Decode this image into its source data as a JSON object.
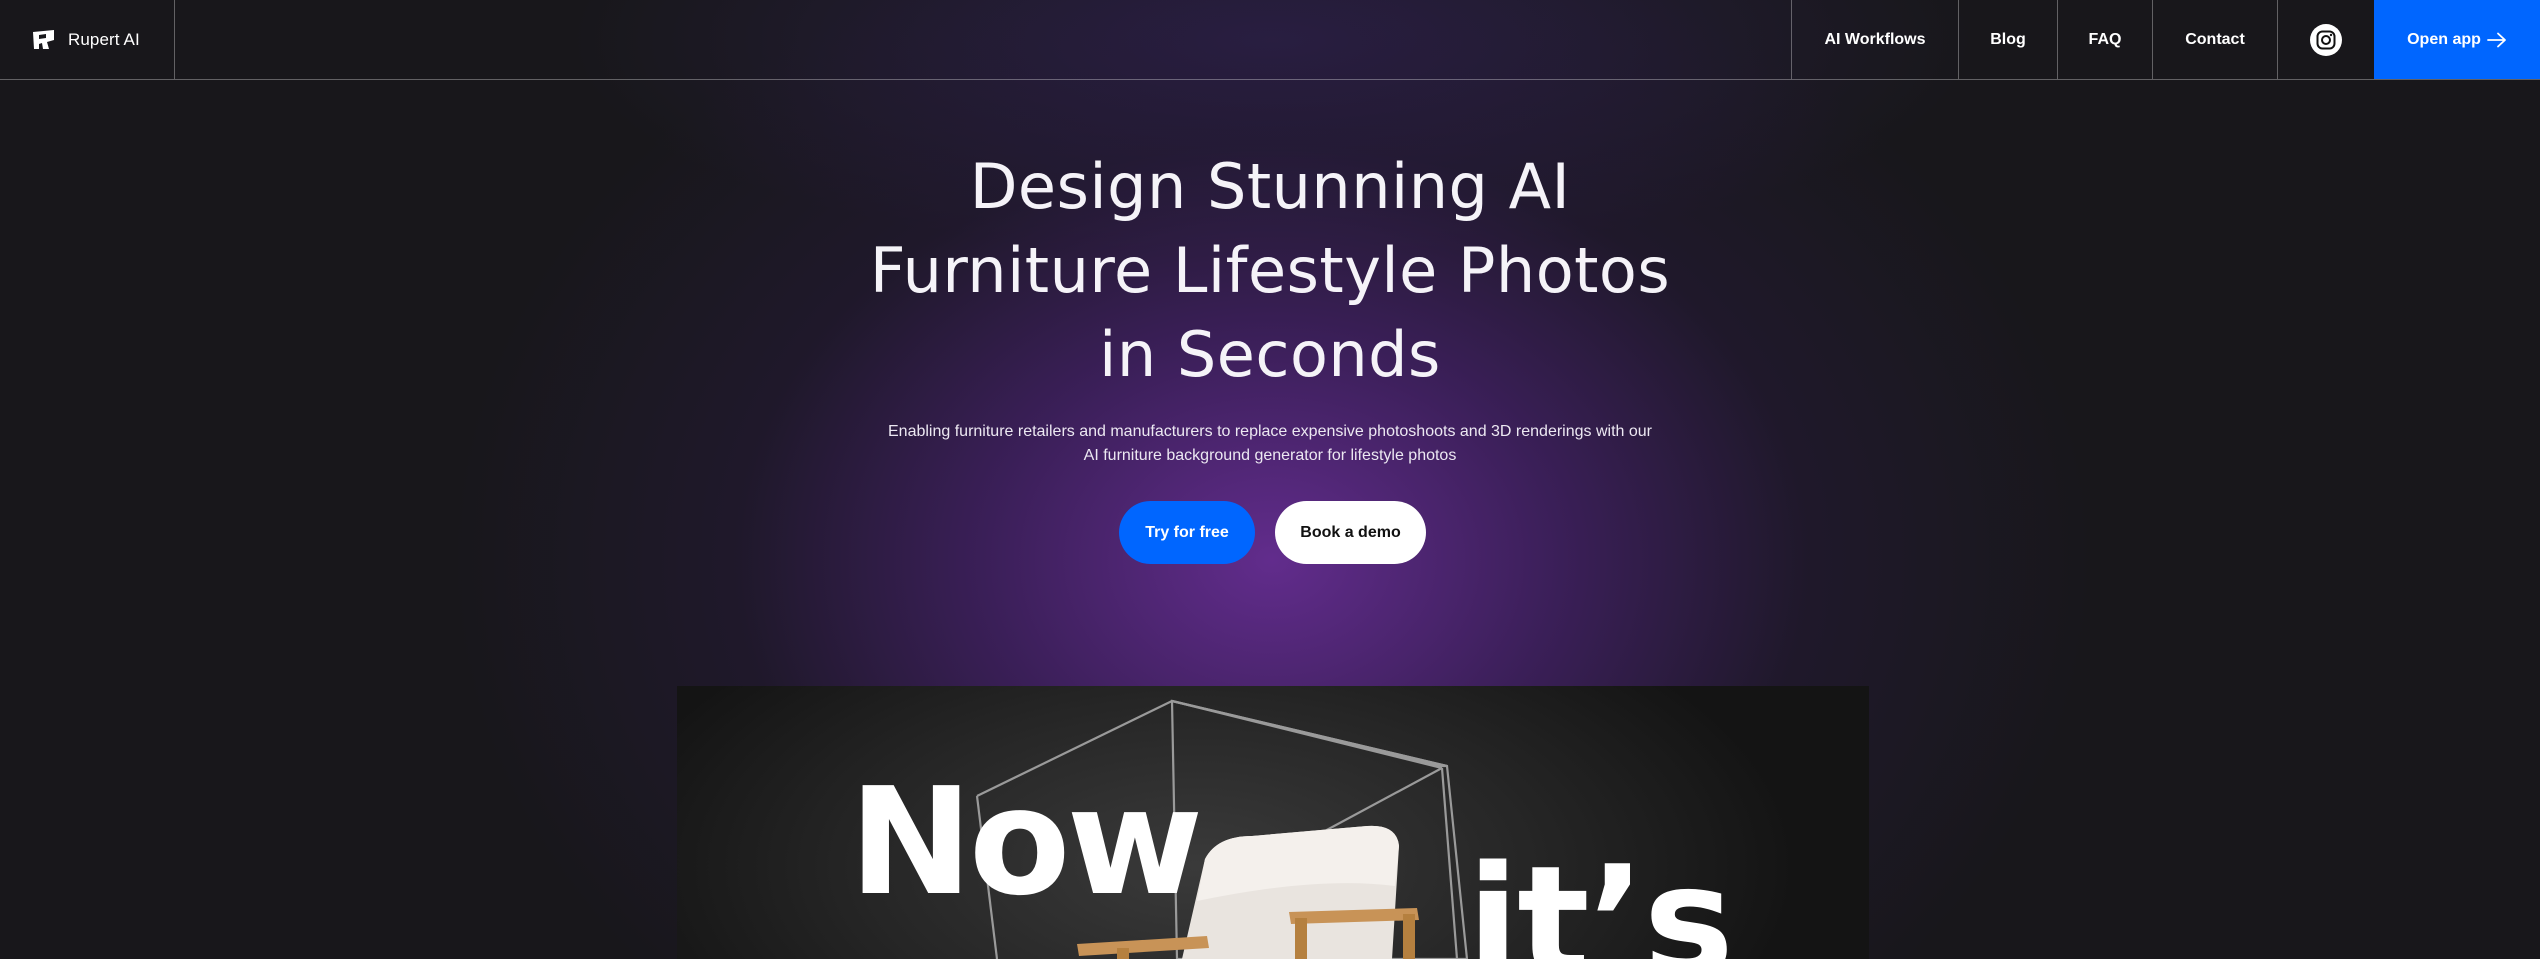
{
  "nav": {
    "brand_name": "Rupert AI",
    "brand_icon": "rupert-logo-icon",
    "items": [
      {
        "label": "AI Workflows"
      },
      {
        "label": "Blog"
      },
      {
        "label": "FAQ"
      },
      {
        "label": "Contact"
      }
    ],
    "social_icon": "instagram-icon",
    "cta_label": "Open app",
    "cta_icon": "arrow-right-icon"
  },
  "hero": {
    "title_lines": [
      "Design Stunning AI",
      "Furniture Lifestyle Photos",
      "in Seconds"
    ],
    "subtitle_lines": [
      "Enabling furniture retailers and manufacturers to replace expensive photoshoots and 3D renderings with our",
      "AI furniture background generator for lifestyle photos"
    ],
    "primary_cta": "Try for free",
    "secondary_cta": "Book a demo"
  },
  "showcase": {
    "word_1": "Now",
    "word_2": "it’s"
  },
  "colors": {
    "background": "#18171b",
    "accent": "#0066ff",
    "glow": "#682e96",
    "text": "#ffffff"
  }
}
